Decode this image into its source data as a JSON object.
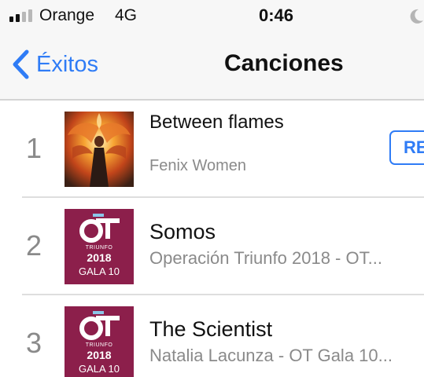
{
  "status_bar": {
    "carrier": "Orange",
    "network": "4G",
    "time": "0:46",
    "signal_bars_filled": 2,
    "signal_bars_total": 4
  },
  "nav": {
    "back_label": "Éxitos",
    "title": "Canciones",
    "accent_color": "#2f7cf6"
  },
  "songs": [
    {
      "rank": "1",
      "title": "Between flames",
      "subtitle": "Fenix Women",
      "artwork": "phoenix-fire-artwork",
      "button_label": "RE"
    },
    {
      "rank": "2",
      "title": "Somos",
      "subtitle": "Operación Triunfo 2018 - OT...",
      "artwork": "ot-logo-artwork",
      "art_text": {
        "small": "TRIUNFO",
        "year": "2018",
        "gala": "GALA 10"
      }
    },
    {
      "rank": "3",
      "title": "The Scientist",
      "subtitle": "Natalia Lacunza - OT Gala 10...",
      "artwork": "ot-logo-artwork",
      "art_text": {
        "small": "TRIUNFO",
        "year": "2018",
        "gala": "GALA 10"
      }
    }
  ]
}
